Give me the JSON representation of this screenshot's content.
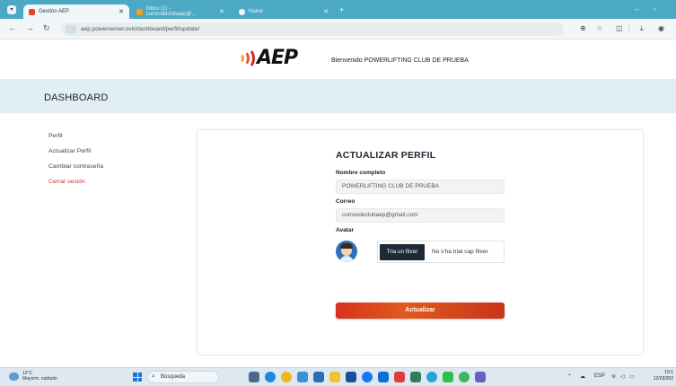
{
  "browser": {
    "tabs": [
      {
        "title": "Gestión AEP",
        "active": true
      },
      {
        "title": "Inbox (1) - correodeclubaep@...",
        "active": false
      },
      {
        "title": "Name",
        "active": false
      }
    ],
    "url": "aep.powerserver.ovh/dashboard/perfil/update/"
  },
  "header": {
    "logo_text": "AEP",
    "welcome": "Bienvenido POWERLIFTING CLUB DE PRUEBA"
  },
  "banner": {
    "title": "DASHBOARD"
  },
  "sidebar": {
    "items": [
      {
        "label": "Perfil"
      },
      {
        "label": "Actualizar Perfil"
      },
      {
        "label": "Cambiar contraseña"
      },
      {
        "label": "Cerrar sesión"
      }
    ]
  },
  "form": {
    "title": "ACTUALIZAR PERFIL",
    "name_label": "Nombre completo",
    "name_value": "POWERLIFTING CLUB DE PRUEBA",
    "email_label": "Correo",
    "email_value": "correodeclubaep@gmail.com",
    "avatar_label": "Avatar",
    "file_button": "Tria un fitxer",
    "file_status": "No s'ha triat cap fitxer",
    "submit": "Actualizar"
  },
  "taskbar": {
    "weather_temp": "12°C",
    "weather_desc": "Mayorm. nublado",
    "search_placeholder": "Búsqueda",
    "lang": "ESP",
    "time": "19:1",
    "date": "12/03/202"
  },
  "colors": {
    "tabbar": "#4ba9c4",
    "banner": "#e2eef5",
    "accent_red": "#d42a2a",
    "button_dark": "#1d2a38"
  }
}
